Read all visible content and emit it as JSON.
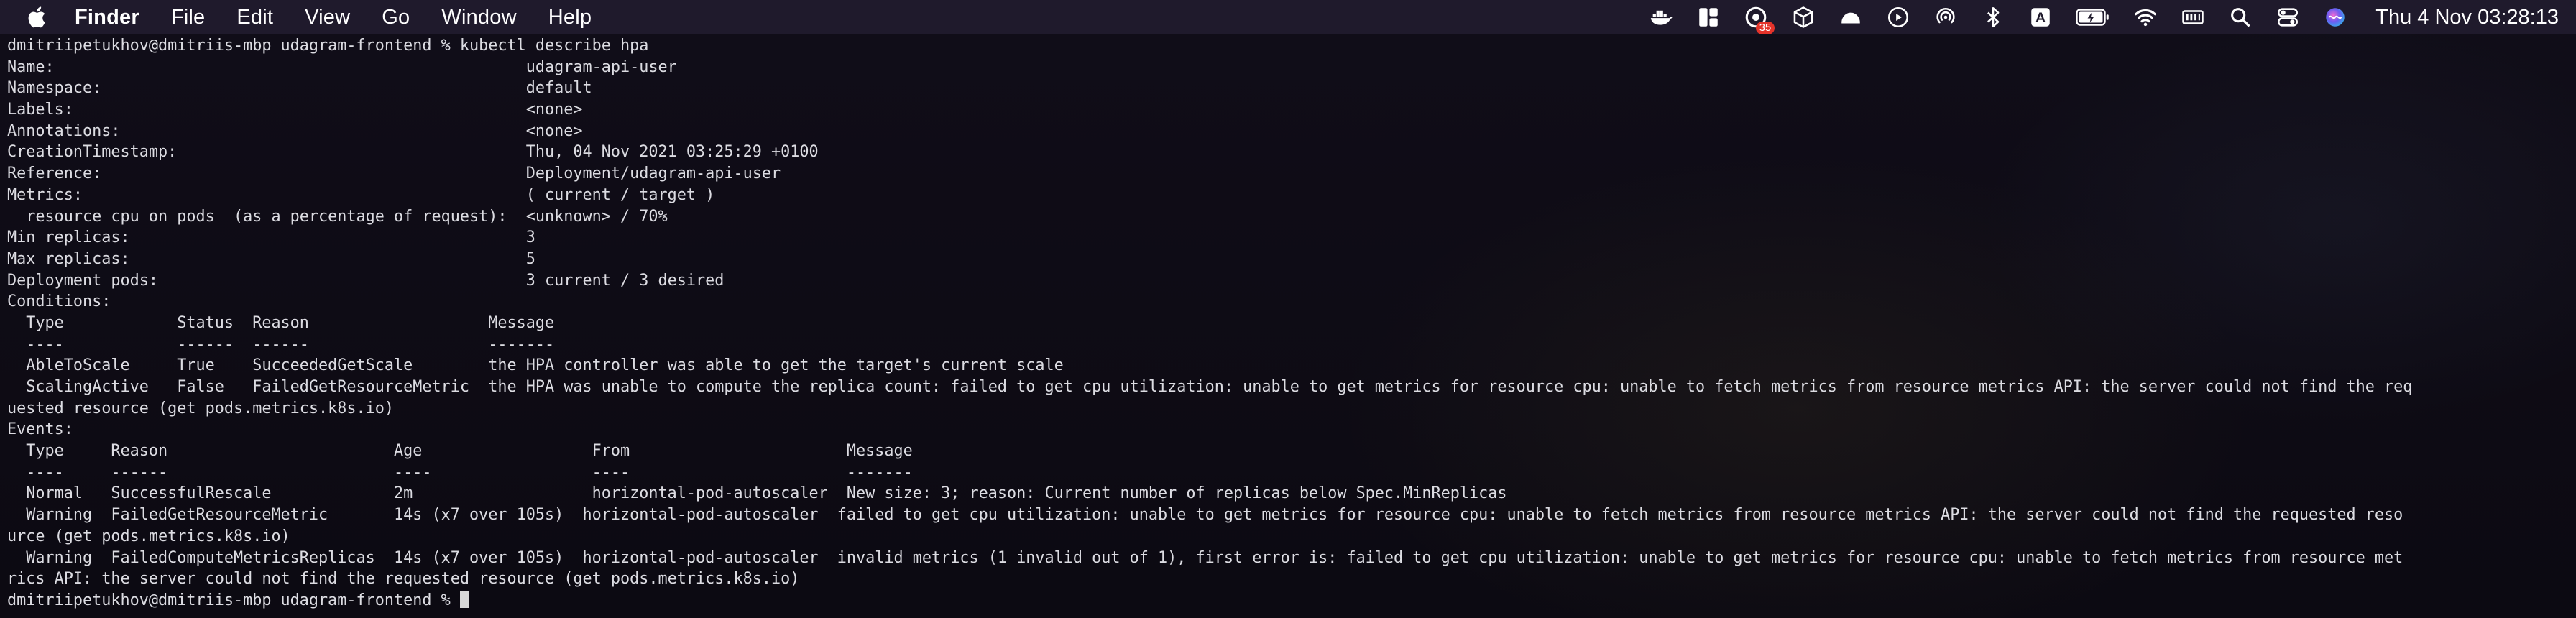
{
  "menubar": {
    "app_name": "Finder",
    "menus": [
      "File",
      "Edit",
      "View",
      "Go",
      "Window",
      "Help"
    ],
    "badge_count": "35",
    "clock": "Thu 4 Nov  03:28:13",
    "tray_icons": [
      "docker-icon",
      "layout-icon",
      "notification-app-icon",
      "box-icon",
      "helmet-icon",
      "play-icon",
      "airdrop-icon",
      "bluetooth-icon",
      "input-source-icon",
      "battery-icon",
      "wifi-icon",
      "memory-icon",
      "search-icon",
      "control-center-icon",
      "siri-icon"
    ],
    "input_source_label": "A"
  },
  "terminal": {
    "prompt": "dmitriipetukhov@dmitriis-mbp udagram-frontend % ",
    "lines": [
      "dmitriipetukhov@dmitriis-mbp udagram-frontend % kubectl describe hpa",
      "Name:                                                  udagram-api-user",
      "Namespace:                                             default",
      "Labels:                                                <none>",
      "Annotations:                                           <none>",
      "CreationTimestamp:                                     Thu, 04 Nov 2021 03:25:29 +0100",
      "Reference:                                             Deployment/udagram-api-user",
      "Metrics:                                               ( current / target )",
      "  resource cpu on pods  (as a percentage of request):  <unknown> / 70%",
      "Min replicas:                                          3",
      "Max replicas:                                          5",
      "Deployment pods:                                       3 current / 3 desired",
      "Conditions:",
      "  Type            Status  Reason                   Message",
      "  ----            ------  ------                   -------",
      "  AbleToScale     True    SucceededGetScale        the HPA controller was able to get the target's current scale",
      "  ScalingActive   False   FailedGetResourceMetric  the HPA was unable to compute the replica count: failed to get cpu utilization: unable to get metrics for resource cpu: unable to fetch metrics from resource metrics API: the server could not find the req",
      "uested resource (get pods.metrics.k8s.io)",
      "Events:",
      "  Type     Reason                        Age                  From                       Message",
      "  ----     ------                        ----                 ----                       -------",
      "  Normal   SuccessfulRescale             2m                   horizontal-pod-autoscaler  New size: 3; reason: Current number of replicas below Spec.MinReplicas",
      "  Warning  FailedGetResourceMetric       14s (x7 over 105s)  horizontal-pod-autoscaler  failed to get cpu utilization: unable to get metrics for resource cpu: unable to fetch metrics from resource metrics API: the server could not find the requested reso",
      "urce (get pods.metrics.k8s.io)",
      "  Warning  FailedComputeMetricsReplicas  14s (x7 over 105s)  horizontal-pod-autoscaler  invalid metrics (1 invalid out of 1), first error is: failed to get cpu utilization: unable to get metrics for resource cpu: unable to fetch metrics from resource met",
      "rics API: the server could not find the requested resource (get pods.metrics.k8s.io)"
    ]
  }
}
